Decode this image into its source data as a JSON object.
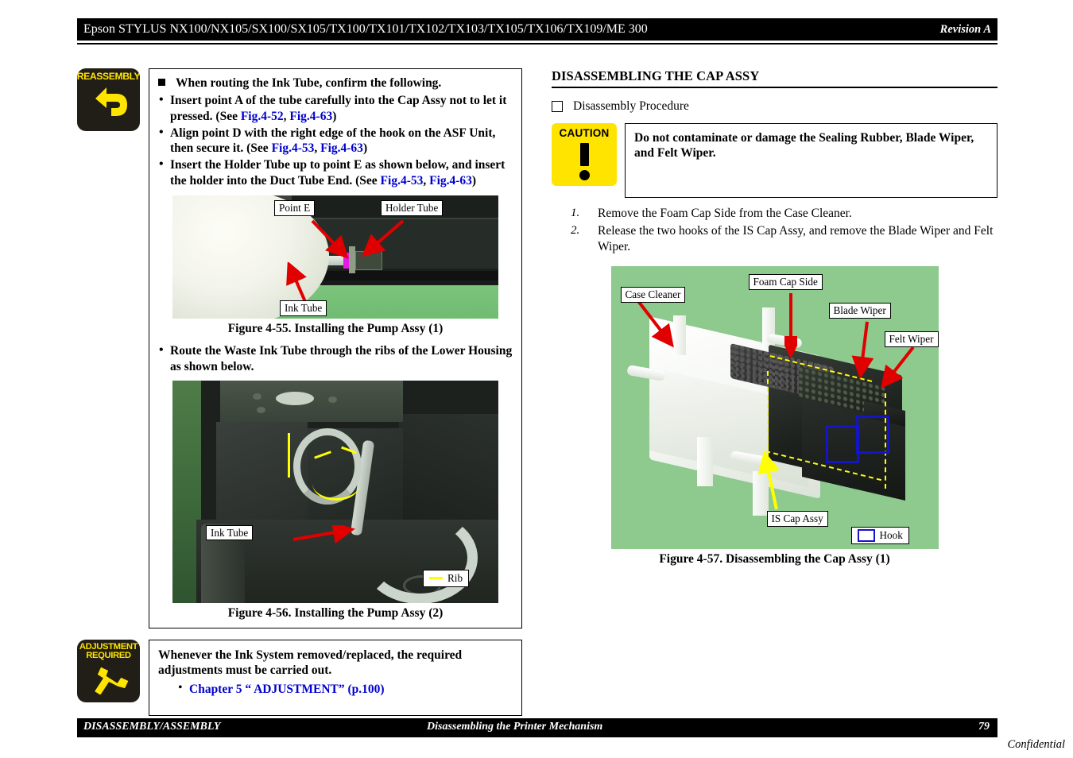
{
  "header": {
    "title": "Epson STYLUS NX100/NX105/SX100/SX105/TX100/TX101/TX102/TX103/TX105/TX106/TX109/ME 300",
    "revision": "Revision A"
  },
  "footer": {
    "left": "DISASSEMBLY/ASSEMBLY",
    "center": "Disassembling the Printer Mechanism",
    "page": "79",
    "confidential": "Confidential"
  },
  "left_column": {
    "reassembly_note": {
      "icon_label_line1": "REASSEMBLY",
      "heading": "When routing the Ink Tube, confirm the following.",
      "bullets": [
        {
          "text_before": "Insert point A of the tube carefully into the Cap Assy not to let it pressed. (See ",
          "link1": "Fig.4-52",
          "sep": ", ",
          "link2": "Fig.4-63",
          "text_after": ")"
        },
        {
          "text_before": "Align point D with the right edge of the hook on the ASF Unit, then secure it. (See ",
          "link1": "Fig.4-53",
          "sep": ", ",
          "link2": "Fig.4-63",
          "text_after": ")"
        },
        {
          "text_before": "Insert the Holder Tube up to point E as shown below, and insert the holder into the Duct Tube End. (See ",
          "link1": "Fig.4-53",
          "sep": ", ",
          "link2": "Fig.4-63",
          "text_after": ")"
        }
      ],
      "route_bullet": "Route the Waste Ink Tube through the ribs of the Lower Housing as shown below."
    },
    "figure_55": {
      "caption": "Figure 4-55.  Installing the Pump Assy (1)",
      "callouts": {
        "point_e": "Point E",
        "holder_tube": "Holder Tube",
        "ink_tube": "Ink Tube"
      }
    },
    "figure_56": {
      "caption": "Figure 4-56.  Installing the Pump Assy (2)",
      "callouts": {
        "ink_tube": "Ink Tube"
      },
      "legend": {
        "rib": "Rib"
      }
    },
    "adjustment_note": {
      "icon_label_line1": "ADJUSTMENT",
      "icon_label_line2": "REQUIRED",
      "text": "Whenever the Ink System removed/replaced, the required adjustments must be carried out.",
      "link": "Chapter 5 “ ADJUSTMENT” (p.100)"
    }
  },
  "right_column": {
    "section_title": "DISASSEMBLING THE CAP ASSY",
    "procedure_label": "Disassembly Procedure",
    "caution": {
      "icon_label": "CAUTION",
      "text": "Do not contaminate or damage the Sealing Rubber, Blade Wiper, and Felt Wiper."
    },
    "steps": [
      {
        "num": "1.",
        "text": "Remove the Foam Cap Side from the Case Cleaner."
      },
      {
        "num": "2.",
        "text": "Release the two hooks of the IS Cap Assy, and remove the Blade Wiper and Felt Wiper."
      }
    ],
    "figure_57": {
      "caption": "Figure 4-57.  Disassembling the Cap Assy (1)",
      "callouts": {
        "case_cleaner": "Case Cleaner",
        "foam_cap_side": "Foam Cap Side",
        "blade_wiper": "Blade Wiper",
        "felt_wiper": "Felt Wiper",
        "is_cap_assy": "IS Cap Assy"
      },
      "legend": {
        "hook": "Hook"
      }
    }
  },
  "colors": {
    "link": "#0000cf",
    "icon_yellow": "#ffe400",
    "icon_black": "#211d17",
    "arrow_red": "#e00000",
    "marker_yellow": "#ffff00",
    "hook_blue": "#1515c8",
    "photo_green": "#8ec98e"
  }
}
